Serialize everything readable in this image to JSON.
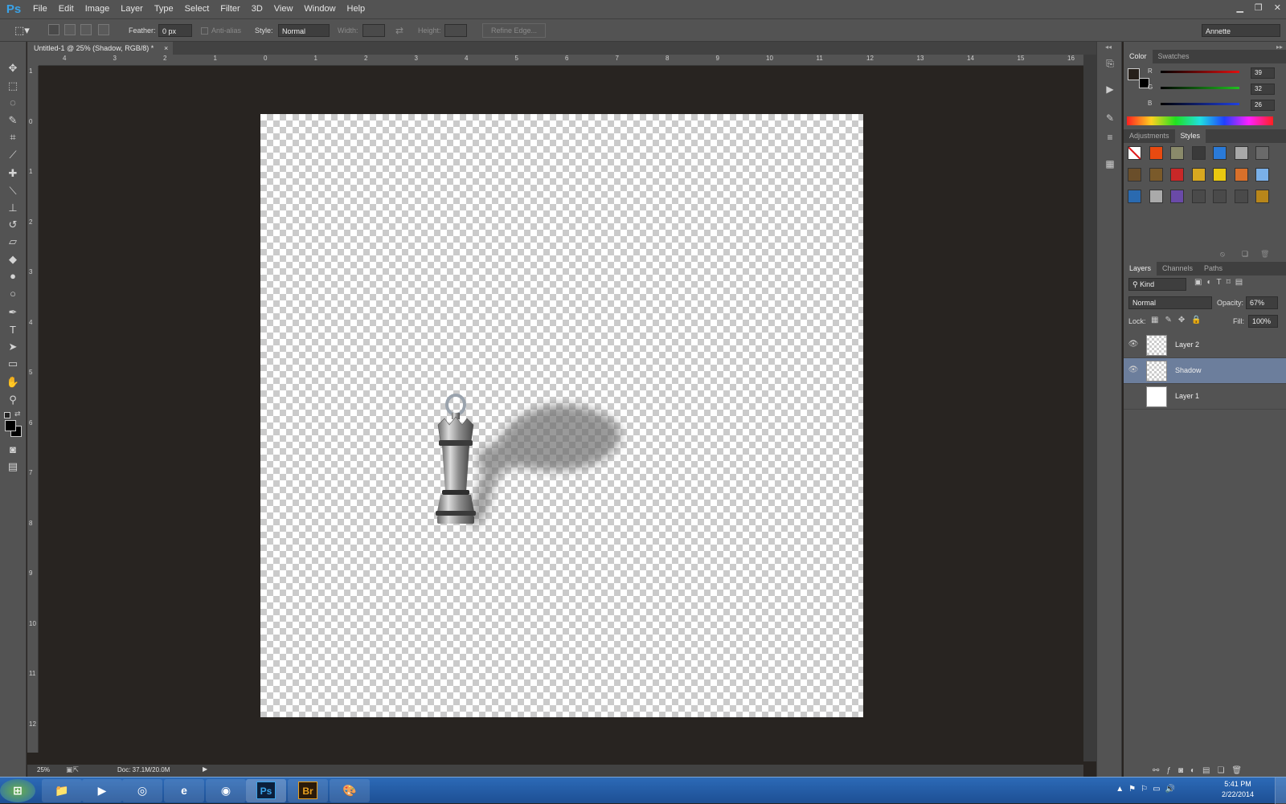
{
  "app": {
    "logo": "Ps"
  },
  "menu": {
    "items": [
      "File",
      "Edit",
      "Image",
      "Layer",
      "Type",
      "Select",
      "Filter",
      "3D",
      "View",
      "Window",
      "Help"
    ]
  },
  "window_controls": [
    "minimize-icon",
    "restore-icon",
    "close-icon"
  ],
  "options": {
    "feather_label": "Feather:",
    "feather_value": "0 px",
    "antialias_label": "Anti-alias",
    "style_label": "Style:",
    "style_value": "Normal",
    "width_label": "Width:",
    "height_label": "Height:",
    "refine_edge_label": "Refine Edge...",
    "workspace": "Annette"
  },
  "document": {
    "tab_title": "Untitled-1 @ 25% (Shadow, RGB/8) *",
    "close_glyph": "×",
    "zoom": "25%",
    "doc_size": "Doc: 37.1M/20.0M"
  },
  "rulers": {
    "horizontal": [
      "4",
      "3",
      "2",
      "1",
      "0",
      "1",
      "2",
      "3",
      "4",
      "5",
      "6",
      "7",
      "8",
      "9",
      "10",
      "11",
      "12",
      "13",
      "14",
      "15",
      "16"
    ],
    "vertical": [
      "1",
      "0",
      "1",
      "2",
      "3",
      "4",
      "5",
      "6",
      "7",
      "8",
      "9",
      "10",
      "11",
      "12"
    ]
  },
  "color_panel": {
    "tabs": [
      "Color",
      "Swatches"
    ],
    "active_tab": "Color",
    "r_label": "R",
    "r_value": "39",
    "g_label": "G",
    "g_value": "32",
    "b_label": "B",
    "b_value": "26",
    "foreground": "#27201a",
    "background": "#000000"
  },
  "styles_panel": {
    "tabs": [
      "Adjustments",
      "Styles"
    ],
    "active_tab": "Styles",
    "swatches": [
      "#ffffff",
      "#e84a10",
      "#8a8a6a",
      "#3a3a3a",
      "#2a7ad8",
      "#a8a8a8",
      "#6a6a6a",
      "#6a4e2a",
      "#7a5a2a",
      "#c82828",
      "#d8a820",
      "#e8c810",
      "#d8702a",
      "#7ab0e8",
      "#2a6ab0",
      "#aaaaaa",
      "#6a4aa8",
      "#4a4a4a",
      "#4a4a4a",
      "#4a4a4a",
      "#b8861a"
    ]
  },
  "layers_panel": {
    "tabs": [
      "Layers",
      "Channels",
      "Paths"
    ],
    "active_tab": "Layers",
    "filter_kind": "Kind",
    "blend_mode": "Normal",
    "opacity_label": "Opacity:",
    "opacity_value": "67%",
    "lock_label": "Lock:",
    "fill_label": "Fill:",
    "fill_value": "100%",
    "layers": [
      {
        "name": "Layer 2",
        "visible": true,
        "selected": false
      },
      {
        "name": "Shadow",
        "visible": true,
        "selected": true
      },
      {
        "name": "Layer 1",
        "visible": false,
        "selected": false
      }
    ]
  },
  "tools": [
    "move-tool-icon",
    "marquee-tool-icon",
    "lasso-tool-icon",
    "quick-select-tool-icon",
    "crop-tool-icon",
    "eyedropper-tool-icon",
    "healing-brush-tool-icon",
    "brush-tool-icon",
    "clone-stamp-tool-icon",
    "history-brush-tool-icon",
    "eraser-tool-icon",
    "paint-bucket-tool-icon",
    "blur-tool-icon",
    "dodge-tool-icon",
    "pen-tool-icon",
    "type-tool-icon",
    "path-select-tool-icon",
    "shape-tool-icon",
    "hand-tool-icon",
    "zoom-tool-icon"
  ],
  "taskbar": {
    "time": "5:41 PM",
    "date": "2/22/2014",
    "apps": [
      "start-button",
      "explorer-icon",
      "media-player-icon",
      "globe-app-icon",
      "internet-explorer-icon",
      "chrome-icon",
      "photoshop-icon",
      "bridge-icon",
      "paint-icon"
    ],
    "photoshop_label": "Ps",
    "bridge_label": "Br"
  }
}
